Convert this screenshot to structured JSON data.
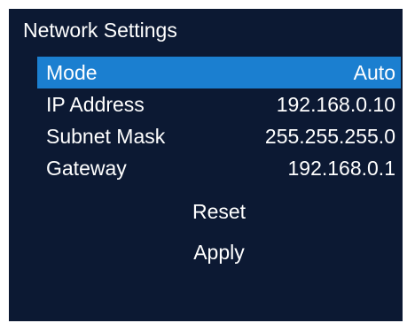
{
  "screen": {
    "title": "Network Settings",
    "items": [
      {
        "label": "Mode",
        "value": "Auto"
      },
      {
        "label": "IP Address",
        "value": "192.168.0.10"
      },
      {
        "label": "Subnet Mask",
        "value": "255.255.255.0"
      },
      {
        "label": "Gateway",
        "value": "192.168.0.1"
      }
    ],
    "actions": {
      "reset": "Reset",
      "apply": "Apply"
    }
  },
  "colors": {
    "background": "#0c1933",
    "highlight": "#1b7fd0",
    "text": "#ffffff"
  }
}
